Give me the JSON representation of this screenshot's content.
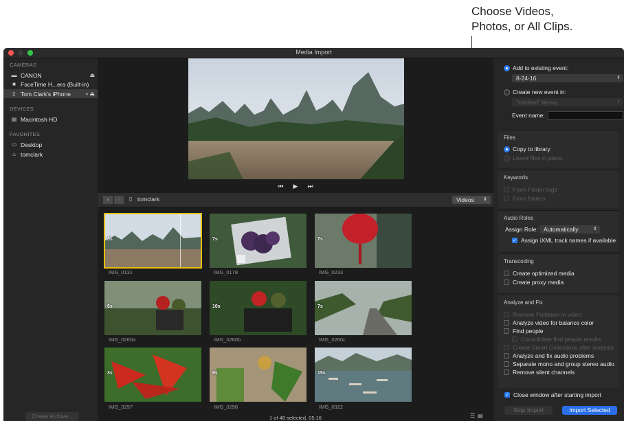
{
  "callout": {
    "line1": "Choose Videos,",
    "line2": "Photos, or All Clips."
  },
  "window": {
    "title": "Media Import"
  },
  "sidebar": {
    "cameras_header": "CAMERAS",
    "cameras": [
      {
        "label": "CANON",
        "icon": "camera-icon"
      },
      {
        "label": "FaceTime H...era (Built-in)",
        "icon": "video-camera-icon"
      },
      {
        "label": "Tom Clark's iPhone",
        "icon": "iphone-icon"
      }
    ],
    "devices_header": "DEVICES",
    "devices": [
      {
        "label": "Macintosh HD",
        "icon": "hard-drive-icon"
      }
    ],
    "favorites_header": "FAVORITES",
    "favorites": [
      {
        "label": "Desktop",
        "icon": "desktop-icon"
      },
      {
        "label": "tomclark",
        "icon": "home-icon"
      }
    ],
    "create_archive": "Create Archive..."
  },
  "browser": {
    "path": "tomclark",
    "filter": "Videos",
    "clips": [
      {
        "name": "IMG_0131",
        "duration": "5s"
      },
      {
        "name": "IMG_0178",
        "duration": "7s"
      },
      {
        "name": "IMG_0233",
        "duration": "7s"
      },
      {
        "name": "IMG_0260a",
        "duration": "6s"
      },
      {
        "name": "IMG_0260b",
        "duration": "10s"
      },
      {
        "name": "IMG_0260c",
        "duration": "7s"
      },
      {
        "name": "IMG_0297",
        "duration": "3s"
      },
      {
        "name": "IMG_0298",
        "duration": "6s"
      },
      {
        "name": "IMG_0322",
        "duration": "15s"
      }
    ],
    "status": "1 of 48 selected, 05:16"
  },
  "import": {
    "add_existing": "Add to existing event:",
    "event_value": "8-24-16",
    "create_new": "Create new event in:",
    "library_value": "\"Untitled\" library",
    "event_name_label": "Event name:",
    "files_header": "Files",
    "copy_to_library": "Copy to library",
    "leave_in_place": "Leave files in place",
    "keywords_header": "Keywords",
    "from_finder_tags": "From Finder tags",
    "from_folders": "From folders",
    "audio_roles_header": "Audio Roles",
    "assign_role_label": "Assign Role:",
    "assign_role_value": "Automatically",
    "assign_ixml": "Assign iXML track names if available",
    "transcoding_header": "Transcoding",
    "optimized": "Create optimized media",
    "proxy": "Create proxy media",
    "analyze_header": "Analyze and Fix",
    "remove_pulldown": "Remove Pulldown in video",
    "balance_color": "Analyze video for balance color",
    "find_people": "Find people",
    "consolidate": "Consolidate find people results",
    "smart_collections": "Create Smart Collections after analysis",
    "audio_problems": "Analyze and fix audio problems",
    "separate_mono": "Separate mono and group stereo audio",
    "remove_silent": "Remove silent channels",
    "close_window": "Close window after starting import",
    "stop_import": "Stop Import",
    "import_selected": "Import Selected"
  }
}
